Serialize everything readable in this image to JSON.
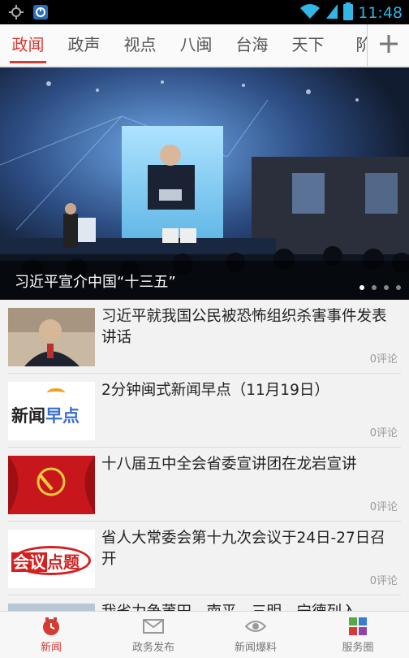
{
  "status_bar": {
    "time": "11:48"
  },
  "tabs": [
    {
      "label": "政闻",
      "active": true
    },
    {
      "label": "政声"
    },
    {
      "label": "视点"
    },
    {
      "label": "八闽"
    },
    {
      "label": "台海"
    },
    {
      "label": "天下"
    },
    {
      "label": "阶"
    }
  ],
  "hero": {
    "caption": "习近平宣介中国“十三五”",
    "dots": 4,
    "active_dot": 0
  },
  "news": [
    {
      "title": "习近平就我国公民被恐怖组织杀害事件发表讲话",
      "comments": "0评论",
      "thumb": "portrait"
    },
    {
      "title": "2分钟闽式新闻早点（11月19日）",
      "comments": "0评论",
      "thumb": "logo-zaodian",
      "logo_text_1": "新闻",
      "logo_text_2": "早点"
    },
    {
      "title": "十八届五中全会省委宣讲团在龙岩宣讲",
      "comments": "0评论",
      "thumb": "party-flag"
    },
    {
      "title": "省人大常委会第十九次会议于24日-27日召开",
      "comments": "0评论",
      "thumb": "logo-huiyi",
      "logo_text_1": "会议",
      "logo_text_2": "点题"
    },
    {
      "title": "我省力争莆田、南平、三明、宁德列入",
      "comments": "",
      "thumb": "partial"
    }
  ],
  "bottom_nav": [
    {
      "label": "新闻",
      "icon": "clock-icon",
      "active": true
    },
    {
      "label": "政务发布",
      "icon": "envelope-icon"
    },
    {
      "label": "新闻爆料",
      "icon": "eye-icon"
    },
    {
      "label": "服务圈",
      "icon": "apps-icon"
    }
  ],
  "colors": {
    "accent": "#d43b33",
    "status_blue": "#33b5e5"
  }
}
